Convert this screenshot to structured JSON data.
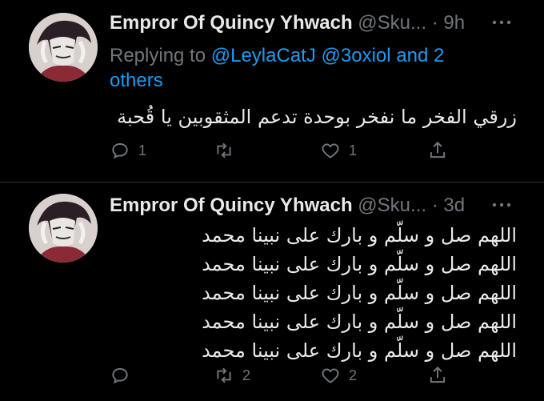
{
  "tweets": [
    {
      "author_name": "Empror Of Quincy Yhwach",
      "author_handle": "@Sku...",
      "separator": "·",
      "time": "9h",
      "more_icon": "more-horizontal-icon",
      "reply_to": {
        "prefix": "Replying to ",
        "mentions": "@LeylaCatJ @3oxiol",
        "join": " and ",
        "others": "2 others"
      },
      "text_lines": [
        "زرقي الفخر ما نفخر بوحدة تدعم المثقوبين يا قُحبة"
      ],
      "actions": {
        "reply_count": "1",
        "retweet_count": "",
        "like_count": "1"
      }
    },
    {
      "author_name": "Empror Of Quincy Yhwach",
      "author_handle": "@Sku...",
      "separator": "·",
      "time": "3d",
      "more_icon": "more-horizontal-icon",
      "text_lines": [
        "اللهم صل و سلّم و بارك على نبينا محمد",
        "اللهم صل و سلّم و بارك على نبينا محمد",
        "اللهم صل و سلّم و بارك على نبينا محمد",
        "اللهم صل و سلّم و بارك على نبينا محمد",
        "اللهم صل و سلّم و بارك على نبينا محمد"
      ],
      "actions": {
        "reply_count": "",
        "retweet_count": "2",
        "like_count": "2"
      }
    }
  ],
  "colors": {
    "background": "#000000",
    "text": "#e7e9ea",
    "muted": "#71767b",
    "link": "#1d9bf0",
    "divider": "#2f3336"
  },
  "icons": [
    "reply-icon",
    "retweet-icon",
    "like-icon",
    "share-icon",
    "more-horizontal-icon"
  ]
}
